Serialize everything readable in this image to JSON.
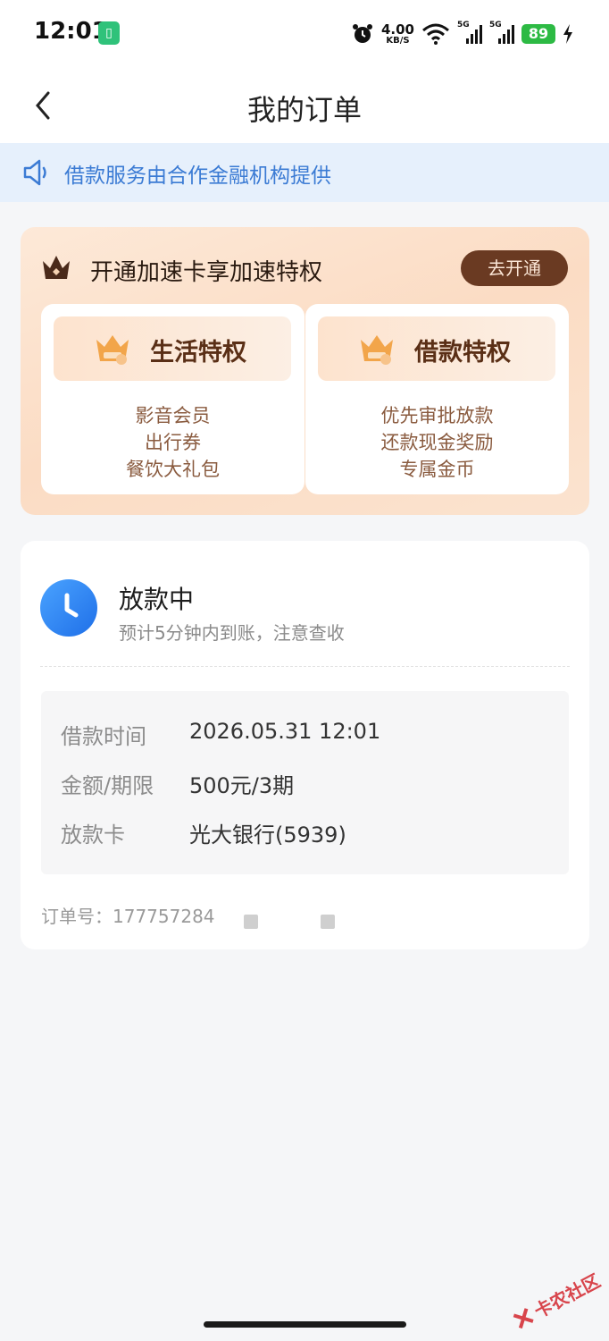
{
  "status_bar": {
    "time": "12:01",
    "net_speed_value": "4.00",
    "net_speed_unit": "KB/S",
    "sim1_label": "5G",
    "sim2_label": "5G",
    "battery_level": "89"
  },
  "header": {
    "title": "我的订单"
  },
  "notice": {
    "text": "借款服务由合作金融机构提供"
  },
  "privilege": {
    "title": "开通加速卡享加速特权",
    "open_button": "去开通",
    "boxes": [
      {
        "title": "生活特权",
        "items": [
          "影音会员",
          "出行券",
          "餐饮大礼包"
        ]
      },
      {
        "title": "借款特权",
        "items": [
          "优先审批放款",
          "还款现金奖励",
          "专属金币"
        ]
      }
    ]
  },
  "order": {
    "status_title": "放款中",
    "status_subtitle": "预计5分钟内到账，注意查收",
    "details": [
      {
        "label": "借款时间",
        "value": "2026.05.31 12:01"
      },
      {
        "label": "金额/期限",
        "value": "500元/3期"
      },
      {
        "label": "放款卡",
        "value": "光大银行(5939)"
      }
    ],
    "order_number_label": "订单号：",
    "order_number_value": "177757284"
  },
  "watermark": {
    "text": "卡农社区"
  },
  "colors": {
    "accent_blue": "#3b7bd4",
    "notice_bg": "#e6f0fc",
    "privilege_brown": "#6a3a22",
    "battery_green": "#2dba44"
  }
}
